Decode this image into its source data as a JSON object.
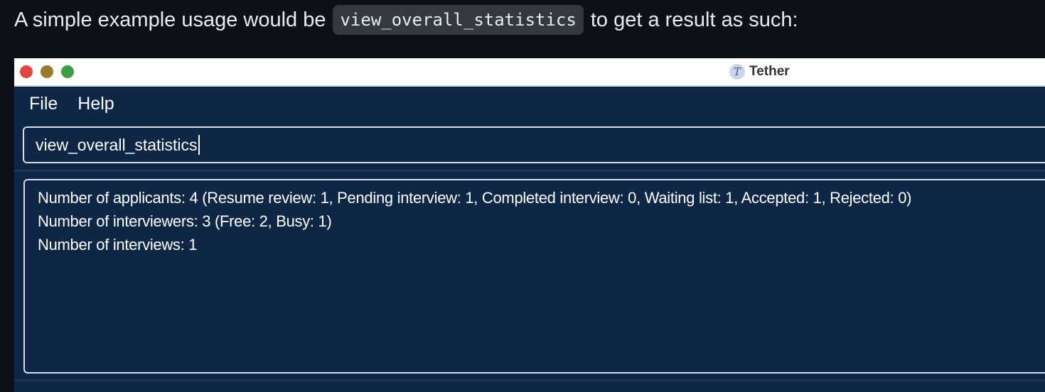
{
  "intro": {
    "text_before": "A simple example usage would be",
    "code": "view_overall_statistics",
    "text_after": "to get a result as such:"
  },
  "window": {
    "title": "Tether",
    "icon_glyph": "T",
    "menu": [
      "File",
      "Help"
    ],
    "command_value": "view_overall_statistics",
    "result_lines": [
      "Number of applicants: 4 (Resume review: 1, Pending interview: 1, Completed interview: 0, Waiting list: 1, Accepted: 1, Rejected: 0)",
      "Number of interviewers: 3 (Free: 2, Busy: 1)",
      "Number of interviews: 1"
    ]
  },
  "colors": {
    "page_background": "#0d1117",
    "app_background": "#0f2747",
    "traffic_red": "#e2463f",
    "traffic_yellow": "#9a7a2c",
    "traffic_green": "#3aa040"
  }
}
